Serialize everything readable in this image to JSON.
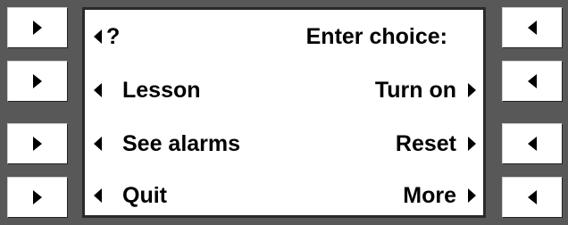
{
  "prompt": {
    "help_glyph": "?",
    "title": "Enter choice:"
  },
  "menu": {
    "left": [
      "Lesson",
      "See alarms",
      "Quit"
    ],
    "right": [
      "Turn on",
      "Reset",
      "More"
    ]
  },
  "icons": {
    "left_softkey": "triangle-right-icon",
    "right_softkey": "triangle-left-icon"
  }
}
